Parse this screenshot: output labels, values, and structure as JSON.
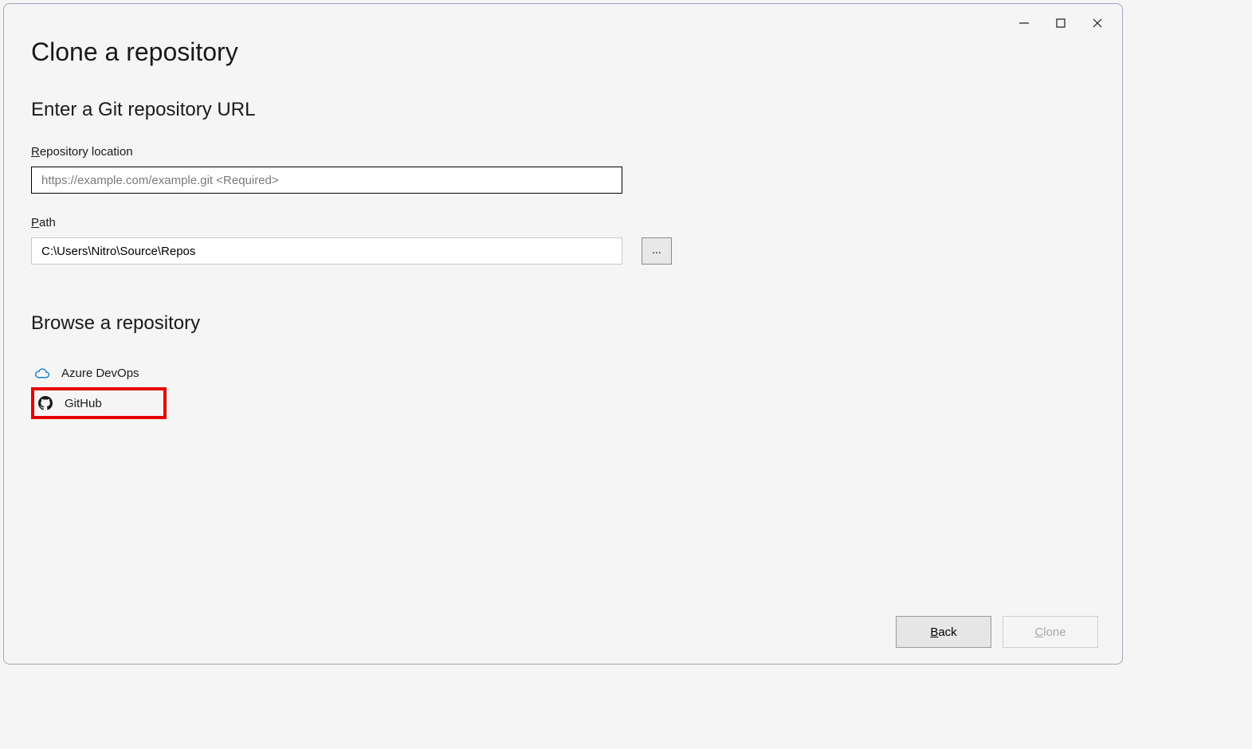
{
  "page": {
    "title": "Clone a repository"
  },
  "url_section": {
    "title": "Enter a Git repository URL",
    "repo_label": "Repository location",
    "repo_placeholder": "https://example.com/example.git <Required>",
    "repo_value": "",
    "path_label": "Path",
    "path_value": "C:\\Users\\Nitro\\Source\\Repos",
    "browse_btn": "..."
  },
  "browse_section": {
    "title": "Browse a repository",
    "options": [
      {
        "label": "Azure DevOps",
        "icon": "cloud"
      },
      {
        "label": "GitHub",
        "icon": "github"
      }
    ]
  },
  "footer": {
    "back": "Back",
    "clone": "Clone"
  }
}
